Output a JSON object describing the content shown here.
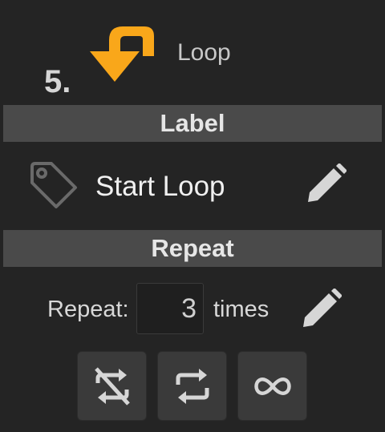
{
  "step": {
    "number": "5.",
    "title": "Loop",
    "icon": "loop-arrow-icon",
    "icon_color": "#f9a71a"
  },
  "label_section": {
    "header": "Label",
    "value": "Start Loop",
    "icon": "tag-icon",
    "edit_icon": "pencil-icon"
  },
  "repeat_section": {
    "header": "Repeat",
    "prefix": "Repeat:",
    "count": "3",
    "suffix": "times",
    "edit_icon": "pencil-icon"
  },
  "mode_buttons": [
    {
      "icon": "repeat-off-icon"
    },
    {
      "icon": "repeat-icon"
    },
    {
      "icon": "infinity-icon"
    }
  ],
  "colors": {
    "background": "#242424",
    "section_bar": "#4a4a4a",
    "button": "#3a3a3a",
    "accent": "#f9a71a",
    "icon": "#d6d6d6"
  }
}
